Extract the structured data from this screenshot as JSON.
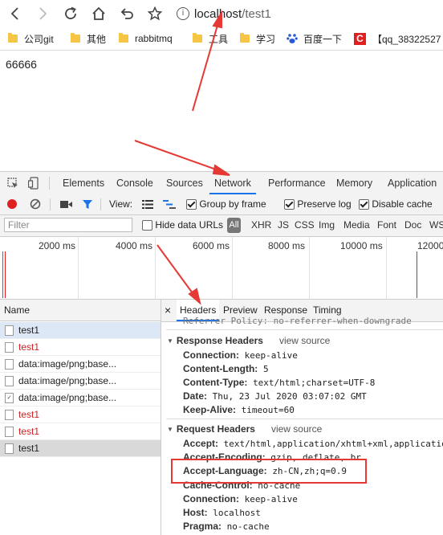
{
  "browser": {
    "url_host": "localhost",
    "url_path": "/test1",
    "info_glyph": "i",
    "bookmarks": [
      "公司git",
      "其他",
      "rabbitmq",
      "工具",
      "学习",
      "百度一下",
      "【qq_38322527"
    ]
  },
  "page": {
    "text": "66666"
  },
  "devtools": {
    "tabs": [
      "Elements",
      "Console",
      "Sources",
      "Network",
      "Performance",
      "Memory",
      "Application"
    ],
    "active_tab": "Network",
    "view_label": "View:",
    "group_by_frame": "Group by frame",
    "preserve_log": "Preserve log",
    "disable_cache": "Disable cache",
    "filter_placeholder": "Filter",
    "hide_data_urls": "Hide data URLs",
    "types": [
      "All",
      "XHR",
      "JS",
      "CSS",
      "Img",
      "Media",
      "Font",
      "Doc",
      "WS"
    ],
    "timeline_ticks": [
      "2000 ms",
      "4000 ms",
      "6000 ms",
      "8000 ms",
      "10000 ms",
      "12000"
    ],
    "name_header": "Name",
    "requests": [
      {
        "name": "test1",
        "status": "selected"
      },
      {
        "name": "test1",
        "status": "error"
      },
      {
        "name": "data:image/png;base...",
        "status": "ok"
      },
      {
        "name": "data:image/png;base...",
        "status": "ok"
      },
      {
        "name": "data:image/png;base...",
        "status": "ok"
      },
      {
        "name": "test1",
        "status": "error"
      },
      {
        "name": "test1",
        "status": "error"
      },
      {
        "name": "test1",
        "status": "grey"
      }
    ],
    "detail_tabs": [
      "Headers",
      "Preview",
      "Response",
      "Timing"
    ],
    "referrer_cut": "Referrer Policy: no-referrer-when-downgrade",
    "response_headers_title": "Response Headers",
    "view_source": "view source",
    "response_headers": [
      {
        "k": "Connection:",
        "v": "keep-alive"
      },
      {
        "k": "Content-Length:",
        "v": "5"
      },
      {
        "k": "Content-Type:",
        "v": "text/html;charset=UTF-8"
      },
      {
        "k": "Date:",
        "v": "Thu, 23 Jul 2020 03:07:02 GMT"
      },
      {
        "k": "Keep-Alive:",
        "v": "timeout=60"
      }
    ],
    "request_headers_title": "Request Headers",
    "request_headers": [
      {
        "k": "Accept:",
        "v": "text/html,application/xhtml+xml,application/xml"
      },
      {
        "k": "Accept-Encoding:",
        "v": "gzip, deflate, br"
      },
      {
        "k": "Accept-Language:",
        "v": "zh-CN,zh;q=0.9"
      },
      {
        "k": "Cache-Control:",
        "v": "no-cache"
      },
      {
        "k": "Connection:",
        "v": "keep-alive"
      },
      {
        "k": "Host:",
        "v": "localhost"
      },
      {
        "k": "Pragma:",
        "v": "no-cache"
      }
    ]
  },
  "colors": {
    "accent": "#1a73e8",
    "annotation": "#e53935",
    "error_text": "#d12020",
    "record": "#e02020"
  }
}
